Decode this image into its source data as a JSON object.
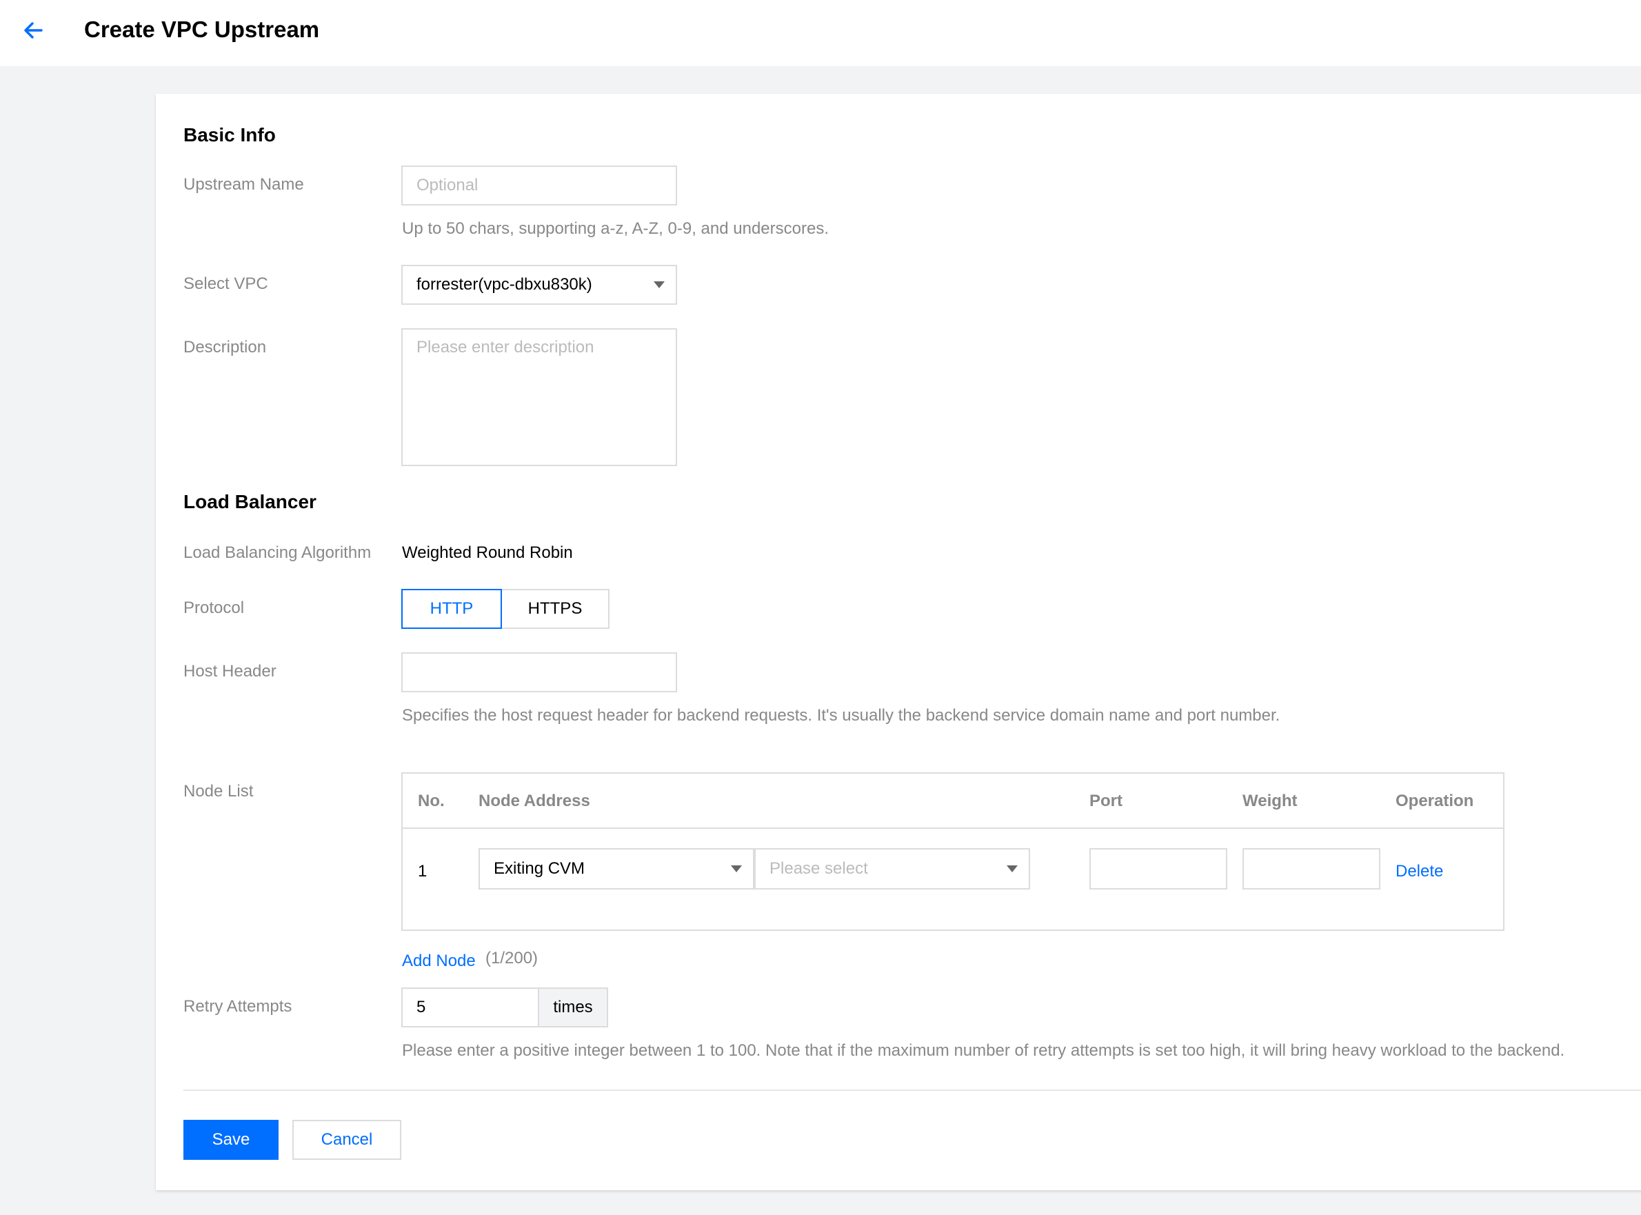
{
  "header": {
    "title": "Create VPC Upstream",
    "back_icon": "arrow-left-icon"
  },
  "colors": {
    "accent": "#006eff",
    "label": "#888888",
    "border": "#dcdcdc",
    "background": "#f2f3f5"
  },
  "basic_info": {
    "section_title": "Basic Info",
    "upstream_name": {
      "label": "Upstream Name",
      "value": "",
      "placeholder": "Optional",
      "hint": "Up to 50 chars, supporting a-z, A-Z, 0-9, and underscores."
    },
    "select_vpc": {
      "label": "Select VPC",
      "value": "forrester(vpc-dbxu830k)"
    },
    "description": {
      "label": "Description",
      "value": "",
      "placeholder": "Please enter description"
    }
  },
  "load_balancer": {
    "section_title": "Load Balancer",
    "algorithm": {
      "label": "Load Balancing Algorithm",
      "value": "Weighted Round Robin"
    },
    "protocol": {
      "label": "Protocol",
      "options": [
        "HTTP",
        "HTTPS"
      ],
      "selected": "HTTP"
    },
    "host_header": {
      "label": "Host Header",
      "value": "",
      "hint": "Specifies the host request header for backend requests. It's usually the backend service domain name and port number."
    },
    "node_list": {
      "label": "Node List",
      "columns": [
        "No.",
        "Node Address",
        "Port",
        "Weight",
        "Operation"
      ],
      "rows": [
        {
          "no": "1",
          "node_type": "Exiting CVM",
          "node_placeholder": "Please select",
          "port": "",
          "weight": "",
          "operation": "Delete"
        }
      ],
      "add_node_label": "Add Node",
      "count": "(1/200)"
    },
    "retry_attempts": {
      "label": "Retry Attempts",
      "value": "5",
      "unit": "times",
      "hint": "Please enter a positive integer between 1 to 100. Note that if the maximum number of retry attempts is set too high, it will bring heavy workload to the backend."
    }
  },
  "actions": {
    "save_label": "Save",
    "cancel_label": "Cancel"
  }
}
